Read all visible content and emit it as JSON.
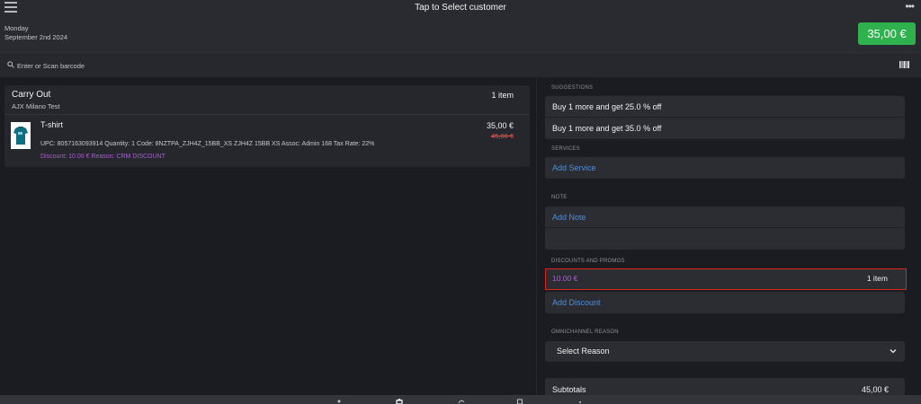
{
  "header": {
    "title": "Tap to Select customer",
    "date_day": "Monday",
    "date_full": "September 2nd 2024",
    "total": "35,00 €",
    "more_label": "•••"
  },
  "search": {
    "placeholder": "Enter or Scan barcode"
  },
  "cart": {
    "type": "Carry Out",
    "store": "AJX Milano Test",
    "item_count": "1 item",
    "items": [
      {
        "name": "T-shirt",
        "details": "UPC: 8057163093914 Quantity: 1 Code: 8NZTPA_ZJH4Z_15BB_XS ZJH4Z 15BB XS Assoc: Admin 168 Tax Rate: 22%",
        "discount": "Discount: 10.00 € Reason: CRM DISCOUNT",
        "price": "35,00 €",
        "old_price": "45,00 €"
      }
    ]
  },
  "suggestions": {
    "label": "SUGGESTIONS",
    "items": [
      "Buy 1 more and get 25.0 % off",
      "Buy 1 more and get 35.0 % off"
    ]
  },
  "services": {
    "label": "SERVICES",
    "add": "Add Service"
  },
  "note": {
    "label": "NOTE",
    "add": "Add Note"
  },
  "discounts": {
    "label": "DISCOUNTS AND PROMOS",
    "amount": "10.00 €",
    "count": "1 item",
    "add": "Add Discount"
  },
  "omnichannel": {
    "label": "OMNICHANNEL REASON",
    "select": "Select Reason"
  },
  "subtotals": {
    "label": "Subtotals",
    "value": "45,00 €"
  },
  "colors": {
    "accent_green": "#2fb24e",
    "link_blue": "#4b8fe0",
    "discount_purple": "#a95fd0",
    "highlight_red": "#e02424"
  }
}
